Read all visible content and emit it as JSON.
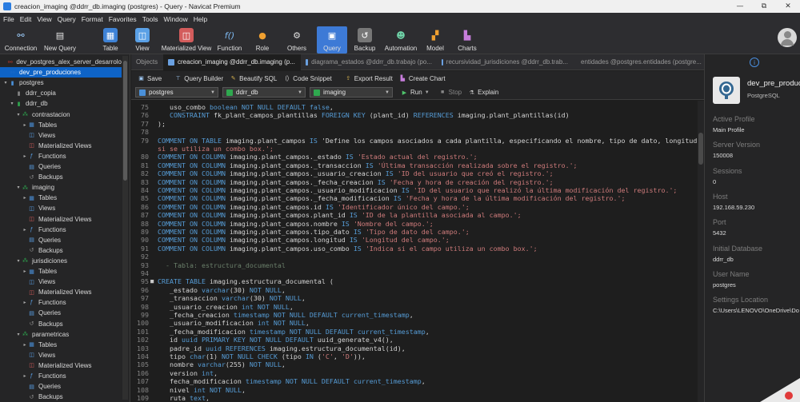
{
  "window": {
    "title": "creacion_imaging @ddrr_db.imaging (postgres) - Query - Navicat Premium",
    "controls": [
      "—",
      "⧉",
      "✕"
    ]
  },
  "menu": [
    "File",
    "Edit",
    "View",
    "Query",
    "Format",
    "Favorites",
    "Tools",
    "Window",
    "Help"
  ],
  "toolbar": {
    "connection": "Connection",
    "new_query": "New Query",
    "table": "Table",
    "view": "View",
    "materialized_view": "Materialized View",
    "function": "Function",
    "role": "Role",
    "others": "Others",
    "query": "Query",
    "backup": "Backup",
    "automation": "Automation",
    "model": "Model",
    "charts": "Charts"
  },
  "sidebar": {
    "items": [
      {
        "label": "dev_postgres_alex_server_desarrolo",
        "level": 0,
        "chev": "",
        "icon": "connection-icon",
        "color": "#c0392b"
      },
      {
        "label": "dev_pre_produciones",
        "level": 0,
        "chev": "",
        "icon": "connection-icon",
        "color": "#1b6ac9",
        "selected": true
      },
      {
        "label": "postgres",
        "level": 0,
        "chev": "▾",
        "icon": "database-icon",
        "color": "#4a90d9"
      },
      {
        "label": "ddrr_copia",
        "level": 1,
        "chev": "",
        "icon": "database-icon",
        "color": "#888888"
      },
      {
        "label": "ddrr_db",
        "level": 1,
        "chev": "▾",
        "icon": "database-icon",
        "color": "#2fa84f"
      },
      {
        "label": "contrastacion",
        "level": 2,
        "chev": "▾",
        "icon": "schema-icon",
        "color": "#2fa84f"
      },
      {
        "label": "Tables",
        "level": 3,
        "chev": "▸",
        "icon": "table-icon",
        "color": "#4a90d9"
      },
      {
        "label": "Views",
        "level": 3,
        "chev": "",
        "icon": "view-icon",
        "color": "#5aa0e6"
      },
      {
        "label": "Materialized Views",
        "level": 3,
        "chev": "",
        "icon": "matview-icon",
        "color": "#d35c5c"
      },
      {
        "label": "Functions",
        "level": 3,
        "chev": "▸",
        "icon": "function-icon",
        "color": "#5aa0e6"
      },
      {
        "label": "Queries",
        "level": 3,
        "chev": "",
        "icon": "query-icon",
        "color": "#5aa0e6"
      },
      {
        "label": "Backups",
        "level": 3,
        "chev": "",
        "icon": "backup-icon",
        "color": "#888888"
      },
      {
        "label": "imaging",
        "level": 2,
        "chev": "▾",
        "icon": "schema-icon",
        "color": "#2fa84f"
      },
      {
        "label": "Tables",
        "level": 3,
        "chev": "▸",
        "icon": "table-icon",
        "color": "#4a90d9"
      },
      {
        "label": "Views",
        "level": 3,
        "chev": "",
        "icon": "view-icon",
        "color": "#5aa0e6"
      },
      {
        "label": "Materialized Views",
        "level": 3,
        "chev": "",
        "icon": "matview-icon",
        "color": "#d35c5c"
      },
      {
        "label": "Functions",
        "level": 3,
        "chev": "▸",
        "icon": "function-icon",
        "color": "#5aa0e6"
      },
      {
        "label": "Queries",
        "level": 3,
        "chev": "",
        "icon": "query-icon",
        "color": "#5aa0e6"
      },
      {
        "label": "Backups",
        "level": 3,
        "chev": "",
        "icon": "backup-icon",
        "color": "#888888"
      },
      {
        "label": "jurisdiciones",
        "level": 2,
        "chev": "▾",
        "icon": "schema-icon",
        "color": "#2fa84f"
      },
      {
        "label": "Tables",
        "level": 3,
        "chev": "▸",
        "icon": "table-icon",
        "color": "#4a90d9"
      },
      {
        "label": "Views",
        "level": 3,
        "chev": "",
        "icon": "view-icon",
        "color": "#5aa0e6"
      },
      {
        "label": "Materialized Views",
        "level": 3,
        "chev": "",
        "icon": "matview-icon",
        "color": "#d35c5c"
      },
      {
        "label": "Functions",
        "level": 3,
        "chev": "▸",
        "icon": "function-icon",
        "color": "#5aa0e6"
      },
      {
        "label": "Queries",
        "level": 3,
        "chev": "",
        "icon": "query-icon",
        "color": "#5aa0e6"
      },
      {
        "label": "Backups",
        "level": 3,
        "chev": "",
        "icon": "backup-icon",
        "color": "#888888"
      },
      {
        "label": "parametricas",
        "level": 2,
        "chev": "▾",
        "icon": "schema-icon",
        "color": "#2fa84f"
      },
      {
        "label": "Tables",
        "level": 3,
        "chev": "▸",
        "icon": "table-icon",
        "color": "#4a90d9"
      },
      {
        "label": "Views",
        "level": 3,
        "chev": "",
        "icon": "view-icon",
        "color": "#5aa0e6"
      },
      {
        "label": "Materialized Views",
        "level": 3,
        "chev": "",
        "icon": "matview-icon",
        "color": "#d35c5c"
      },
      {
        "label": "Functions",
        "level": 3,
        "chev": "▸",
        "icon": "function-icon",
        "color": "#5aa0e6"
      },
      {
        "label": "Queries",
        "level": 3,
        "chev": "",
        "icon": "query-icon",
        "color": "#5aa0e6"
      },
      {
        "label": "Backups",
        "level": 3,
        "chev": "",
        "icon": "backup-icon",
        "color": "#888888"
      }
    ]
  },
  "tabs": [
    {
      "label": "Objects",
      "active": false
    },
    {
      "label": "creacion_imaging @ddrr_db.imaging (p...",
      "active": true
    },
    {
      "label": "diagrama_estados @ddrr_db.trabajo (po...",
      "active": false
    },
    {
      "label": "recursividad_jurisdiciones @ddrr_db.trab...",
      "active": false
    },
    {
      "label": "entidades @postgres.entidades (postgre...",
      "active": false
    }
  ],
  "actions": {
    "save": "Save",
    "query_builder": "Query Builder",
    "beautify": "Beautify SQL",
    "snippet": "Code Snippet",
    "export": "Export Result",
    "create_chart": "Create Chart"
  },
  "selectors": {
    "connection": "postgres",
    "database": "ddrr_db",
    "schema": "imaging",
    "run": "Run",
    "stop": "Stop",
    "explain": "Explain"
  },
  "code": [
    {
      "n": "75",
      "f": "",
      "t": "   uso_combo boolean NOT NULL DEFAULT false,"
    },
    {
      "n": "76",
      "f": "",
      "t": "   CONSTRAINT fk_plant_campos_plantillas FOREIGN KEY (plant_id) REFERENCES imaging.plant_plantillas(id)"
    },
    {
      "n": "77",
      "f": "",
      "t": ");"
    },
    {
      "n": "78",
      "f": "",
      "t": ""
    },
    {
      "n": "79",
      "f": "",
      "t": "COMMENT ON TABLE imaging.plant_campos IS 'Define los campos asociados a cada plantilla, especificando el nombre, tipo de dato, longitud y"
    },
    {
      "n": "",
      "f": "",
      "t": "si se utiliza un combo box.';"
    },
    {
      "n": "80",
      "f": "",
      "t": "COMMENT ON COLUMN imaging.plant_campos._estado IS 'Estado actual del registro.';"
    },
    {
      "n": "81",
      "f": "",
      "t": "COMMENT ON COLUMN imaging.plant_campos._transaccion IS 'Última transacción realizada sobre el registro.';"
    },
    {
      "n": "82",
      "f": "",
      "t": "COMMENT ON COLUMN imaging.plant_campos._usuario_creacion IS 'ID del usuario que creó el registro.';"
    },
    {
      "n": "83",
      "f": "",
      "t": "COMMENT ON COLUMN imaging.plant_campos._fecha_creacion IS 'Fecha y hora de creación del registro.';"
    },
    {
      "n": "84",
      "f": "",
      "t": "COMMENT ON COLUMN imaging.plant_campos._usuario_modificacion IS 'ID del usuario que realizó la última modificación del registro.';"
    },
    {
      "n": "85",
      "f": "",
      "t": "COMMENT ON COLUMN imaging.plant_campos._fecha_modificacion IS 'Fecha y hora de la última modificación del registro.';"
    },
    {
      "n": "86",
      "f": "",
      "t": "COMMENT ON COLUMN imaging.plant_campos.id IS 'Identificador único del campo.';"
    },
    {
      "n": "87",
      "f": "",
      "t": "COMMENT ON COLUMN imaging.plant_campos.plant_id IS 'ID de la plantilla asociada al campo.';"
    },
    {
      "n": "88",
      "f": "",
      "t": "COMMENT ON COLUMN imaging.plant_campos.nombre IS 'Nombre del campo.';"
    },
    {
      "n": "89",
      "f": "",
      "t": "COMMENT ON COLUMN imaging.plant_campos.tipo_dato IS 'Tipo de dato del campo.';"
    },
    {
      "n": "90",
      "f": "",
      "t": "COMMENT ON COLUMN imaging.plant_campos.longitud IS 'Longitud del campo.';"
    },
    {
      "n": "91",
      "f": "",
      "t": "COMMENT ON COLUMN imaging.plant_campos.uso_combo IS 'Indica si el campo utiliza un combo box.';"
    },
    {
      "n": "92",
      "f": "",
      "t": ""
    },
    {
      "n": "93",
      "f": "",
      "t": "  - Tabla: estructura_documental"
    },
    {
      "n": "94",
      "f": "",
      "t": ""
    },
    {
      "n": "95",
      "f": "■",
      "t": "CREATE TABLE imaging.estructura_documental ("
    },
    {
      "n": "96",
      "f": "",
      "t": "   _estado varchar(30) NOT NULL,"
    },
    {
      "n": "97",
      "f": "",
      "t": "   _transaccion varchar(30) NOT NULL,"
    },
    {
      "n": "98",
      "f": "",
      "t": "   _usuario_creacion int NOT NULL,"
    },
    {
      "n": "99",
      "f": "",
      "t": "   _fecha_creacion timestamp NOT NULL DEFAULT current_timestamp,"
    },
    {
      "n": "100",
      "f": "",
      "t": "   _usuario_modificacion int NOT NULL,"
    },
    {
      "n": "101",
      "f": "",
      "t": "   _fecha_modificacion timestamp NOT NULL DEFAULT current_timestamp,"
    },
    {
      "n": "102",
      "f": "",
      "t": "   id uuid PRIMARY KEY NOT NULL DEFAULT uuid_generate_v4(),"
    },
    {
      "n": "103",
      "f": "",
      "t": "   padre_id uuid REFERENCES imaging.estructura_documental(id),"
    },
    {
      "n": "104",
      "f": "",
      "t": "   tipo char(1) NOT NULL CHECK (tipo IN ('C', 'D')),"
    },
    {
      "n": "105",
      "f": "",
      "t": "   nombre varchar(255) NOT NULL,"
    },
    {
      "n": "106",
      "f": "",
      "t": "   version int,"
    },
    {
      "n": "107",
      "f": "",
      "t": "   fecha_modificacion timestamp NOT NULL DEFAULT current_timestamp,"
    },
    {
      "n": "108",
      "f": "",
      "t": "   nivel int NOT NULL,"
    },
    {
      "n": "109",
      "f": "",
      "t": "   ruta text,"
    }
  ],
  "right_panel": {
    "name": "dev_pre_produciones",
    "type": "PostgreSQL",
    "fields": [
      {
        "label": "Active Profile",
        "value": "Main Profile"
      },
      {
        "label": "Server Version",
        "value": "150008"
      },
      {
        "label": "Sessions",
        "value": "0"
      },
      {
        "label": "Host",
        "value": "192.168.59.230"
      },
      {
        "label": "Port",
        "value": "5432"
      },
      {
        "label": "Initial Database",
        "value": "ddrr_db"
      },
      {
        "label": "User Name",
        "value": "postgres"
      },
      {
        "label": "Settings Location",
        "value": "C:\\Users\\LENOVO\\OneDrive\\Do"
      }
    ]
  }
}
